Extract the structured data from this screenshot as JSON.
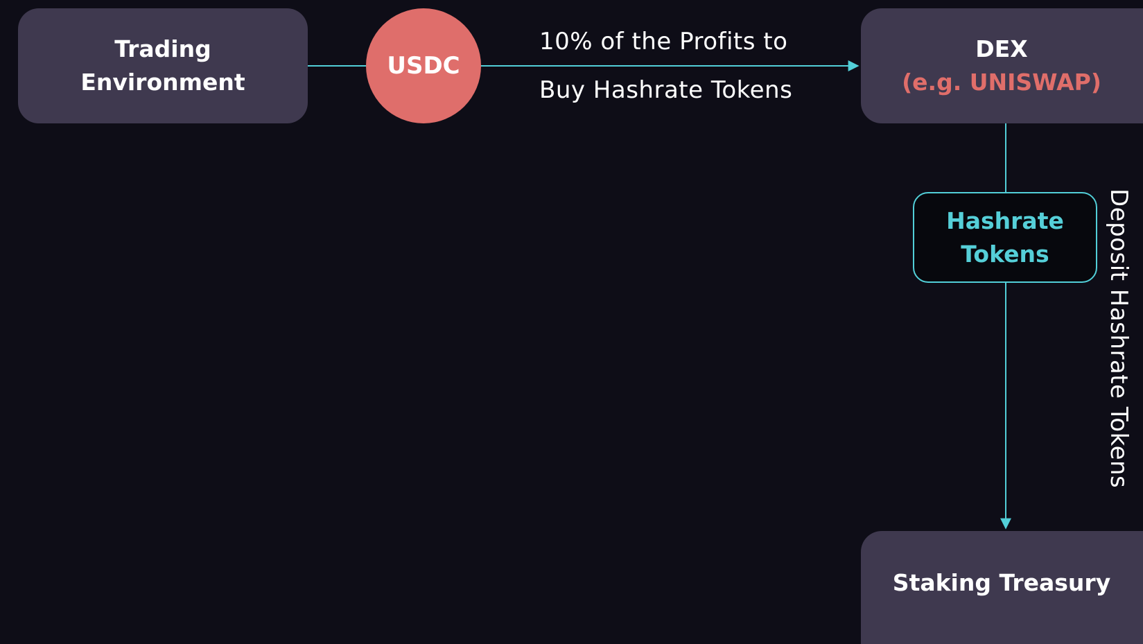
{
  "nodes": {
    "trading": {
      "line1": "Trading",
      "line2": "Environment"
    },
    "usdc": {
      "label": "USDC"
    },
    "dex": {
      "title": "DEX",
      "subtitle": "(e.g. UNISWAP)"
    },
    "hashrate_tokens": {
      "line1": "Hashrate",
      "line2": "Tokens"
    },
    "staking": {
      "label": "Staking Treasury"
    }
  },
  "edges": {
    "buy": {
      "line1": "10% of the Profits to",
      "line2": "Buy Hashrate Tokens"
    },
    "deposit": {
      "label": "Deposit Hashrate Tokens"
    }
  },
  "colors": {
    "background": "#0e0d17",
    "box": "#3f394f",
    "accent": "#52cfd8",
    "usdc": "#df6e6b"
  }
}
